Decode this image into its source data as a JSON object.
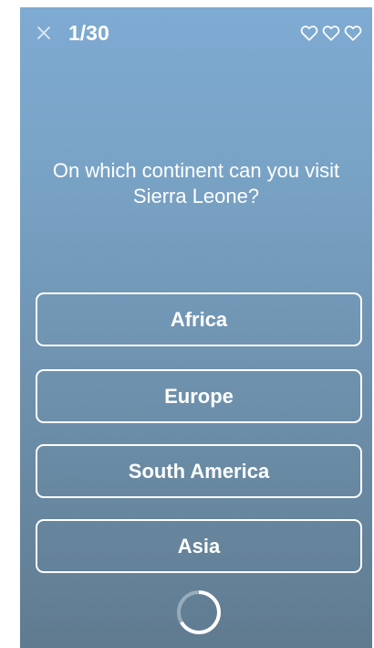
{
  "header": {
    "close_icon": "close-icon",
    "counter": "1/30",
    "lives": [
      "heart-outline-icon",
      "heart-outline-icon",
      "heart-outline-icon"
    ]
  },
  "question": {
    "text": "On which continent can you visit Sierra Leone?"
  },
  "answers": [
    {
      "label": "Africa"
    },
    {
      "label": "Europe"
    },
    {
      "label": "South America"
    },
    {
      "label": "Asia"
    }
  ],
  "loader": {
    "icon": "loading-spinner-icon"
  },
  "colors": {
    "background_top": "#7faad2",
    "background_bottom": "#607b90",
    "foreground": "#ffffff"
  }
}
